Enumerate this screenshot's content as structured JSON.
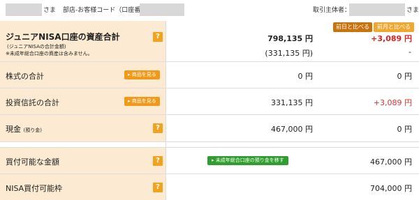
{
  "header": {
    "customer_suffix": "さま",
    "branch_label": "部店-お客様コード（口座番号）",
    "holder_label": "取引主体者：",
    "holder_suffix": "さま"
  },
  "compare": {
    "prev_day_label": "前日と比べる",
    "prev_month_label": "前月と比べる"
  },
  "rows": {
    "total": {
      "label": "ジュニアNISA口座の資産合計",
      "sub1": "(ジュニアNISAの合計金額)",
      "sub2": "※未成年総合口座の資産は含みません。",
      "value": "798,135 円",
      "value2": "(331,135 円)",
      "change": "+3,089 円",
      "change2": "-"
    },
    "stocks": {
      "label": "株式の合計",
      "button": "▸ 商品を見る",
      "value": "0 円",
      "change": "0 円"
    },
    "funds": {
      "label": "投資信託の合計",
      "button": "▸ 商品を見る",
      "value": "331,135 円",
      "change": "+3,089 円"
    },
    "cash": {
      "label": "現金",
      "label_small": "(預り金)",
      "value": "467,000 円",
      "change": "0 円"
    },
    "buyable": {
      "label": "買付可能な金額",
      "button": "▸ 未成年総合口座の預り金を移す",
      "value": "467,000 円"
    },
    "nisa_limit": {
      "label": "NISA買付可能枠",
      "value": "704,000 円"
    }
  },
  "help_symbol": "?",
  "colors": {
    "label_bg": "#fcebd2",
    "accent_orange": "#f19a1a",
    "help_orange": "#f2a21e",
    "prev_day_btn": "#c9730f",
    "prev_month_btn": "#f0a830",
    "positive_red": "#e03030",
    "green_button": "#2f9e2f"
  }
}
